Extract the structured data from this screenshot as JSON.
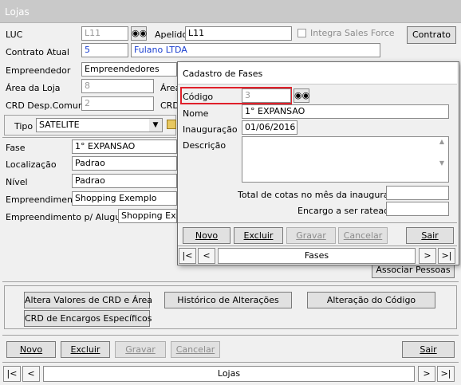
{
  "window": {
    "title": "Lojas"
  },
  "form": {
    "luc_label": "LUC",
    "luc_value": "L11",
    "apelido_label": "Apelido",
    "apelido_value": "L11",
    "integra_label": "Integra Sales Force",
    "contrato_button": "Contrato",
    "contrato_atual_label": "Contrato Atual",
    "contrato_atual_num": "5",
    "contrato_atual_name": "Fulano LTDA",
    "empreendedor_label": "Empreendedor",
    "empreendedor_value": "Empreendedores",
    "area_loja_label": "Área da Loja",
    "area_loja_value": "8",
    "area2_label": "Área",
    "crd_desp_label": "CRD Desp.Comum",
    "crd_desp_value": "2",
    "crd2_label": "CRD",
    "tipo_label": "Tipo",
    "tipo_value": "SATELITE",
    "fase_label": "Fase",
    "fase_value": "1° EXPANSAO",
    "localizacao_label": "Localização",
    "localizacao_value": "Padrao",
    "nivel_label": "Nível",
    "nivel_value": "Padrao",
    "empreendimento_label": "Empreendimento",
    "empreendimento_value": "Shopping Exemplo",
    "emp_alugueis_label": "Empreendimento p/ Aluguéis",
    "emp_alugueis_value": "Shopping Exem",
    "associar_button": "Associar Pessoas"
  },
  "actions": {
    "altera_valores": "Altera Valores de CRD e Área",
    "historico": "Histórico de Alterações",
    "alteracao_codigo": "Alteração do Código",
    "crd_encargos": "CRD de Encargos Específicos"
  },
  "main_toolbar": {
    "novo": "Novo",
    "excluir": "Excluir",
    "gravar": "Gravar",
    "cancelar": "Cancelar",
    "sair": "Sair"
  },
  "main_nav": {
    "label": "Lojas",
    "first": "|<",
    "prev": "<",
    "next": ">",
    "last": ">|"
  },
  "dialog": {
    "title": "Cadastro de Fases",
    "codigo_label": "Código",
    "codigo_value": "3",
    "nome_label": "Nome",
    "nome_value": "1° EXPANSAO",
    "inauguracao_label": "Inauguração",
    "inauguracao_value": "01/06/2016",
    "descricao_label": "Descrição",
    "descricao_value": "",
    "total_cotas_label": "Total de cotas no mês da inauguração",
    "total_cotas_value": "",
    "encargo_label": "Encargo a ser rateado",
    "encargo_value": "",
    "toolbar": {
      "novo": "Novo",
      "excluir": "Excluir",
      "gravar": "Gravar",
      "cancelar": "Cancelar",
      "sair": "Sair"
    },
    "nav": {
      "label": "Fases",
      "first": "|<",
      "prev": "<",
      "next": ">",
      "last": ">|"
    }
  },
  "icons": {
    "binoculars": "binoculars-icon",
    "folder": "folder-icon",
    "dropdown": "chevron-down-icon"
  }
}
